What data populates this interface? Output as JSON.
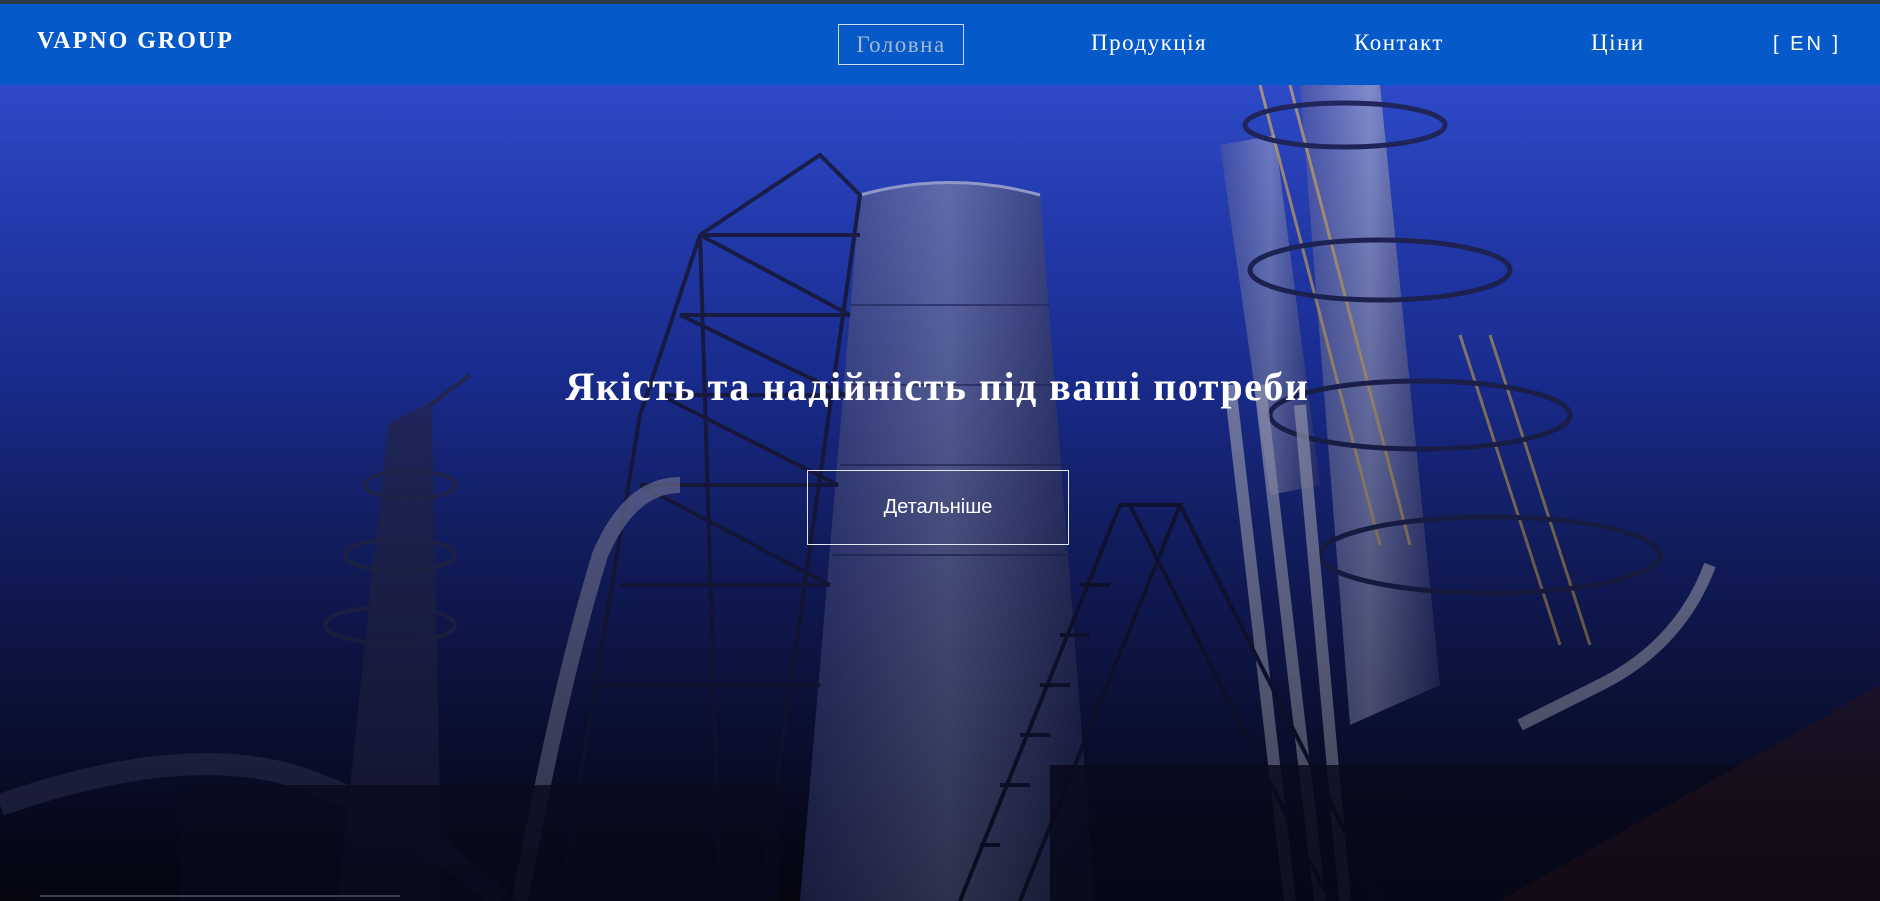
{
  "brand": {
    "name": "VAPNO GROUP"
  },
  "nav": {
    "items": [
      {
        "label": "Головна",
        "active": true
      },
      {
        "label": "Продукція",
        "active": false
      },
      {
        "label": "Контакт",
        "active": false
      },
      {
        "label": "Ціни",
        "active": false
      }
    ],
    "language": "[ EN ]"
  },
  "hero": {
    "title": "Якість та надійність під ваші потреби",
    "button_label": "Детальніше"
  },
  "colors": {
    "navbar": "#0559c9",
    "hero_top": "#2d49c8",
    "hero_bottom": "#0a0c22",
    "text": "#ffffff"
  }
}
